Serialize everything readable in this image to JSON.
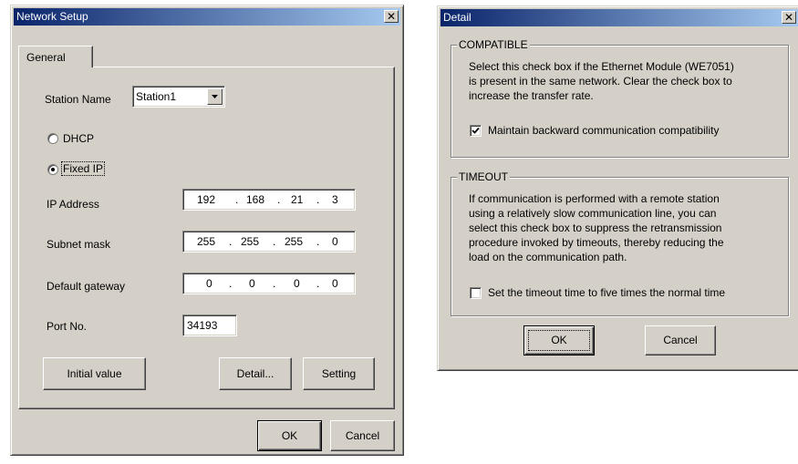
{
  "network_setup": {
    "title": "Network Setup",
    "close_glyph": "✕",
    "tab_general": "General",
    "station_name_label": "Station Name",
    "station_name_value": "Station1",
    "dhcp_label": "DHCP",
    "fixed_ip_label": "Fixed IP",
    "ip_address_label": "IP Address",
    "ip_address": [
      "192",
      "168",
      "21",
      "3"
    ],
    "subnet_mask_label": "Subnet mask",
    "subnet_mask": [
      "255",
      "255",
      "255",
      "0"
    ],
    "default_gateway_label": "Default gateway",
    "default_gateway": [
      "0",
      "0",
      "0",
      "0"
    ],
    "port_label": "Port No.",
    "port_value": "34193",
    "initial_value_button": "Initial value",
    "detail_button": "Detail...",
    "setting_button": "Setting",
    "ok_button": "OK",
    "cancel_button": "Cancel",
    "selected_mode": "Fixed IP",
    "dot": "."
  },
  "detail": {
    "title": "Detail",
    "close_glyph": "✕",
    "compatible_title": "COMPATIBLE",
    "compatible_text_1": "Select this check box if the Ethernet Module (WE7051)",
    "compatible_text_2": "is present in the same network. Clear the check box to",
    "compatible_text_3": "increase the transfer rate.",
    "compatible_checkbox_label": "Maintain backward communication compatibility",
    "compatible_checked": true,
    "timeout_title": "TIMEOUT",
    "timeout_text_1": "If communication is performed with a remote station",
    "timeout_text_2": "using  a relatively slow communication line, you can",
    "timeout_text_3": "select this check box to suppress the retransmission",
    "timeout_text_4": "procedure invoked by timeouts, thereby reducing the",
    "timeout_text_5": "load on the  communication path.",
    "timeout_checkbox_label": "Set the timeout time to five times the normal time",
    "timeout_checked": false,
    "ok_button": "OK",
    "cancel_button": "Cancel"
  },
  "colors": {
    "face": "#d4d0c8",
    "title_start": "#0a246a",
    "title_end": "#a6caf0"
  }
}
